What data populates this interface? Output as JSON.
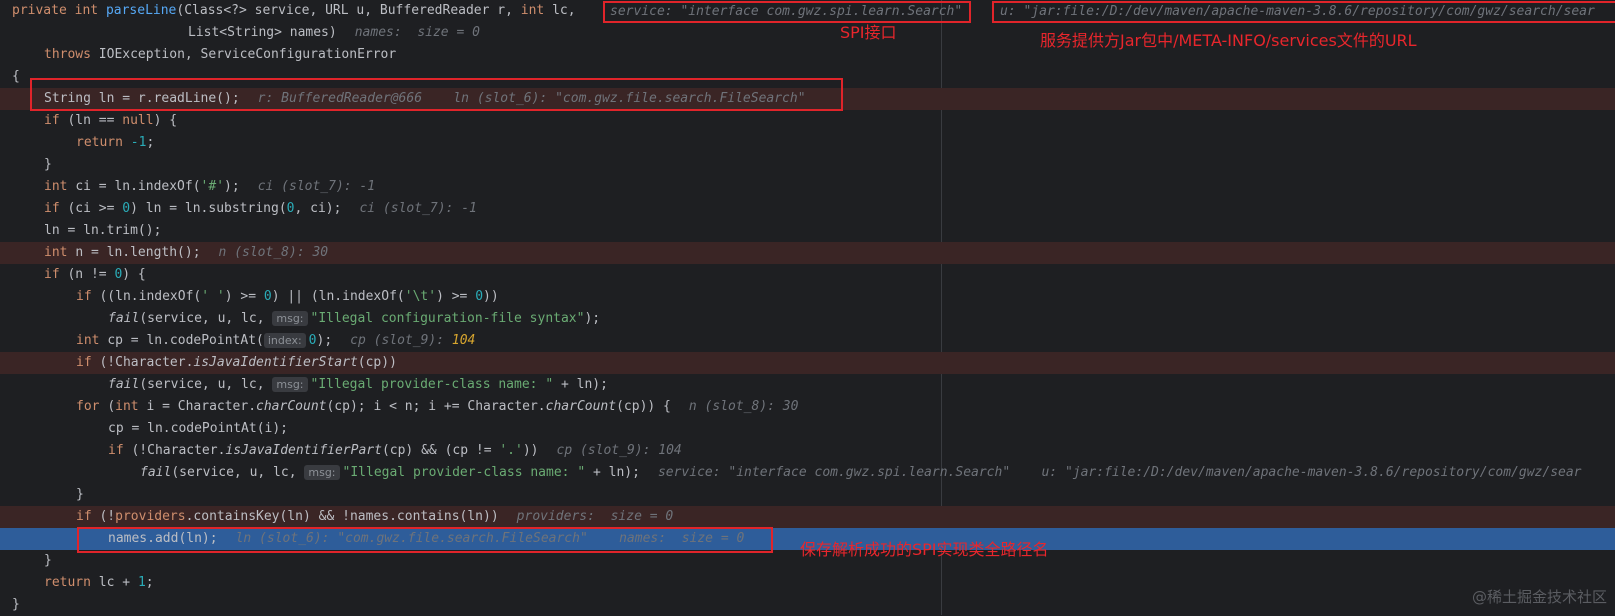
{
  "lines": [
    {
      "tokens": [
        [
          "kw",
          "private "
        ],
        [
          "kw",
          "int "
        ],
        [
          "fn",
          "parseLine"
        ],
        [
          "plain",
          "(Class<?> service, URL u, BufferedReader r, "
        ],
        [
          "kw",
          "int "
        ],
        [
          "plain",
          "lc,"
        ]
      ]
    },
    {
      "tokens": [
        [
          "plain",
          "List<String> names)"
        ]
      ],
      "hint": "names:  size = 0"
    },
    {
      "tokens": [
        [
          "kw",
          "throws "
        ],
        [
          "plain",
          "IOException, ServiceConfigurationError"
        ]
      ]
    },
    {
      "tokens": [
        [
          "plain",
          "{"
        ]
      ]
    },
    {
      "tokens": [
        [
          "plain",
          "String ln = r.readLine();"
        ]
      ],
      "hint": "r: BufferedReader@666    ln (slot_6): \"com.gwz.file.search.FileSearch\""
    },
    {
      "tokens": [
        [
          "kw",
          "if "
        ],
        [
          "plain",
          "(ln == "
        ],
        [
          "kw",
          "null"
        ],
        [
          "plain",
          ") {"
        ]
      ]
    },
    {
      "tokens": [
        [
          "kw",
          "return "
        ],
        [
          "num",
          "-1"
        ],
        [
          "plain",
          ";"
        ]
      ]
    },
    {
      "tokens": [
        [
          "plain",
          "}"
        ]
      ]
    },
    {
      "tokens": [
        [
          "kw",
          "int "
        ],
        [
          "plain",
          "ci = ln.indexOf("
        ],
        [
          "str",
          "'#'"
        ],
        [
          "plain",
          ");"
        ]
      ],
      "hint": "ci (slot_7): -1"
    },
    {
      "tokens": [
        [
          "kw",
          "if "
        ],
        [
          "plain",
          "(ci >= "
        ],
        [
          "num",
          "0"
        ],
        [
          "plain",
          ") ln = ln.substring("
        ],
        [
          "num",
          "0"
        ],
        [
          "plain",
          ", ci);"
        ]
      ],
      "hint": "ci (slot_7): -1"
    },
    {
      "tokens": [
        [
          "plain",
          "ln = ln.trim();"
        ]
      ]
    },
    {
      "tokens": [
        [
          "kw",
          "int "
        ],
        [
          "plain",
          "n = ln.length();"
        ]
      ],
      "hint": "n (slot_8): 30"
    },
    {
      "tokens": [
        [
          "kw",
          "if "
        ],
        [
          "plain",
          "(n != "
        ],
        [
          "num",
          "0"
        ],
        [
          "plain",
          ") {"
        ]
      ]
    },
    {
      "tokens": [
        [
          "kw",
          "if "
        ],
        [
          "plain",
          "((ln.indexOf("
        ],
        [
          "str",
          "' '"
        ],
        [
          "plain",
          ") >= "
        ],
        [
          "num",
          "0"
        ],
        [
          "plain",
          ") || (ln.indexOf("
        ],
        [
          "str",
          "'\\t'"
        ],
        [
          "plain",
          ") >= "
        ],
        [
          "num",
          "0"
        ],
        [
          "plain",
          "))"
        ]
      ]
    },
    {
      "tokens": [
        [
          "it",
          "fail"
        ],
        [
          "plain",
          "(service, u, lc, "
        ],
        [
          "pill",
          "msg:"
        ],
        [
          "str",
          "\"Illegal configuration-file syntax\""
        ],
        [
          "plain",
          ");"
        ]
      ]
    },
    {
      "tokens": [
        [
          "kw",
          "int "
        ],
        [
          "plain",
          "cp = ln.codePointAt("
        ],
        [
          "pill",
          "index:"
        ],
        [
          "num",
          "0"
        ],
        [
          "plain",
          ");"
        ]
      ],
      "hint": "cp (slot_9): ",
      "hintval": "104"
    },
    {
      "tokens": [
        [
          "kw",
          "if "
        ],
        [
          "plain",
          "(!Character."
        ],
        [
          "it",
          "isJavaIdentifierStart"
        ],
        [
          "plain",
          "(cp))"
        ]
      ]
    },
    {
      "tokens": [
        [
          "it",
          "fail"
        ],
        [
          "plain",
          "(service, u, lc, "
        ],
        [
          "pill",
          "msg:"
        ],
        [
          "str",
          "\"Illegal provider-class name: \""
        ],
        [
          "plain",
          " + ln);"
        ]
      ]
    },
    {
      "tokens": [
        [
          "kw",
          "for "
        ],
        [
          "plain",
          "("
        ],
        [
          "kw",
          "int "
        ],
        [
          "plain",
          "i = Character."
        ],
        [
          "it",
          "charCount"
        ],
        [
          "plain",
          "(cp); i < n; i += Character."
        ],
        [
          "it",
          "charCount"
        ],
        [
          "plain",
          "(cp)) {"
        ]
      ],
      "hint": "n (slot_8): 30"
    },
    {
      "tokens": [
        [
          "plain",
          "cp = ln.codePointAt(i);"
        ]
      ]
    },
    {
      "tokens": [
        [
          "kw",
          "if "
        ],
        [
          "plain",
          "(!Character."
        ],
        [
          "it",
          "isJavaIdentifierPart"
        ],
        [
          "plain",
          "(cp) && (cp != "
        ],
        [
          "str",
          "'.'"
        ],
        [
          "plain",
          "))"
        ]
      ],
      "hint": "cp (slot_9): 104"
    },
    {
      "tokens": [
        [
          "it",
          "fail"
        ],
        [
          "plain",
          "(service, u, lc, "
        ],
        [
          "pill",
          "msg:"
        ],
        [
          "str",
          "\"Illegal provider-class name: \""
        ],
        [
          "plain",
          " + ln);"
        ]
      ],
      "hint": "service: \"interface com.gwz.spi.learn.Search\"    u: \"jar:file:/D:/dev/maven/apache-maven-3.8.6/repository/com/gwz/sear"
    },
    {
      "tokens": [
        [
          "plain",
          "}"
        ]
      ]
    },
    {
      "tokens": [
        [
          "kw",
          "if "
        ],
        [
          "plain",
          "(!"
        ],
        [
          "kwp",
          "providers"
        ],
        [
          "plain",
          ".containsKey(ln) && !names.contains(ln))"
        ]
      ],
      "hint": "providers:  size = 0"
    },
    {
      "tokens": [
        [
          "plain",
          "names.add(ln);"
        ]
      ],
      "hint": "ln (slot_6): \"com.gwz.file.search.FileSearch\"    names:  size = 0"
    },
    {
      "tokens": [
        [
          "plain",
          "}"
        ]
      ]
    },
    {
      "tokens": [
        [
          "kw",
          "return "
        ],
        [
          "plain",
          "lc + "
        ],
        [
          "num",
          "1"
        ],
        [
          "plain",
          ";"
        ]
      ]
    },
    {
      "tokens": [
        [
          "plain",
          "}"
        ]
      ]
    }
  ],
  "inline_hints": {
    "service": "service: \"interface com.gwz.spi.learn.Search\"",
    "url": "u: \"jar:file:/D:/dev/maven/apache-maven-3.8.6/repository/com/gwz/search/sear"
  },
  "annotations": {
    "spi_interface": "SPI接口",
    "services_url": "服务提供方Jar包中/META-INFO/services文件的URL",
    "save_class": "保存解析成功的SPI实现类全路径名"
  },
  "watermark": "@稀土掘金技术社区",
  "colors": {
    "keyword": "#cf8e6d",
    "function": "#56a8f5",
    "number": "#2aacb8",
    "string": "#6aab73",
    "text": "#bcbec4",
    "hint": "#6f737a",
    "highlight_current": "#2e5d9a",
    "highlight_break": "#3a2525",
    "annotation": "#e8262c"
  }
}
